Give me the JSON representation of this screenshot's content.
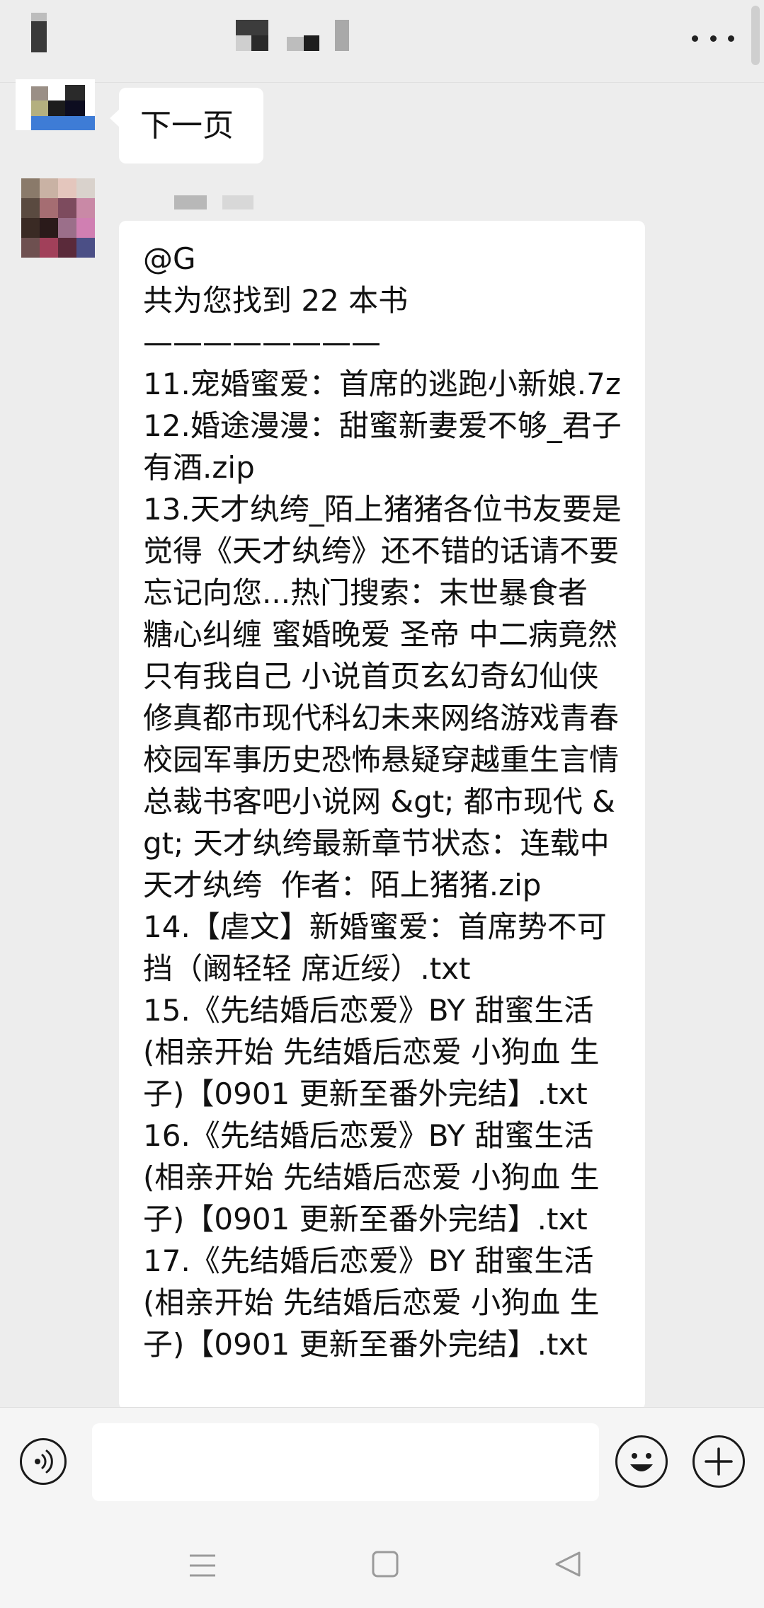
{
  "chat": {
    "messages": [
      {
        "text": "下一页"
      },
      {
        "text": "@G\n共为您找到 22 本书\n————————\n11.宠婚蜜爱：首席的逃跑小新娘.7z\n12.婚途漫漫：甜蜜新妻爱不够_君子有酒.zip\n13.天才纨绔_陌上猪猪各位书友要是觉得《天才纨绔》还不错的话请不要忘记向您...热门搜索：末世暴食者 糖心纠缠 蜜婚晚爱 圣帝 中二病竟然只有我自己 小说首页玄幻奇幻仙侠修真都市现代科幻未来网络游戏青春校园军事历史恐怖悬疑穿越重生言情总裁书客吧小说网 &gt; 都市现代 &gt; 天才纨绔最新章节状态：连载中天才纨绔  作者：陌上猪猪.zip\n14.【虐文】新婚蜜爱：首席势不可挡（阚轻轻 席近绥）.txt\n15.《先结婚后恋爱》BY 甜蜜生活 (相亲开始 先结婚后恋爱 小狗血 生子)【0901 更新至番外完结】.txt\n16.《先结婚后恋爱》BY 甜蜜生活 (相亲开始 先结婚后恋爱 小狗血 生子)【0901 更新至番外完结】.txt\n17.《先结婚后恋爱》BY 甜蜜生活 (相亲开始 先结婚后恋爱 小狗血 生子)【0901 更新至番外完结】.txt"
      }
    ]
  },
  "icons": {
    "more": "more-dots-icon",
    "voice": "voice-icon",
    "emoji": "emoji-icon",
    "plus": "plus-icon",
    "nav_menu": "menu-icon",
    "nav_home": "home-square-icon",
    "nav_back": "back-triangle-icon"
  }
}
